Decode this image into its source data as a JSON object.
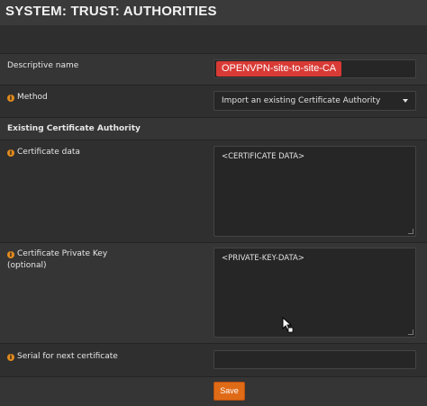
{
  "page": {
    "title": "SYSTEM: TRUST: AUTHORITIES"
  },
  "form": {
    "descriptive_name": {
      "label": "Descriptive name",
      "value": "OPENVPN-site-to-site-CA"
    },
    "method": {
      "label": "Method",
      "selected": "Import an existing Certificate Authority"
    },
    "section_heading": "Existing Certificate Authority",
    "certificate_data": {
      "label": "Certificate data",
      "value": "<CERTIFICATE DATA>"
    },
    "private_key": {
      "label": "Certificate Private Key",
      "sublabel": "(optional)",
      "value": "<PRIVATE-KEY-DATA>"
    },
    "serial": {
      "label": "Serial for next certificate",
      "value": ""
    },
    "save_label": "Save"
  },
  "icons": {
    "info": "info-icon",
    "dropdown": "chevron-down-icon",
    "cursor": "mouse-pointer-icon"
  },
  "colors": {
    "accent": "#e06b17",
    "highlight": "#d83a35",
    "info": "#e08a1e"
  }
}
